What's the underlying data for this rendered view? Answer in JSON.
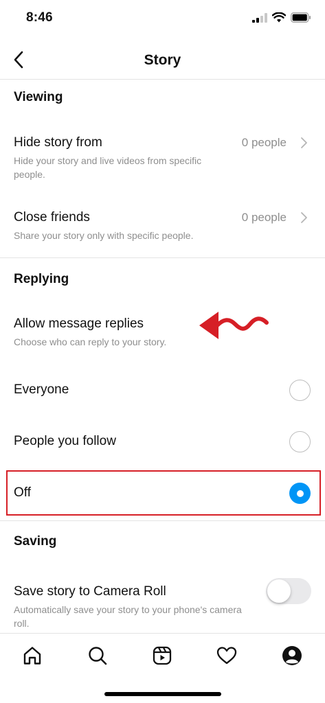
{
  "status_bar": {
    "time": "8:46"
  },
  "header": {
    "title": "Story"
  },
  "viewing": {
    "heading": "Viewing",
    "hide_story": {
      "title": "Hide story from",
      "value": "0 people",
      "desc": "Hide your story and live videos from specific people."
    },
    "close_friends": {
      "title": "Close friends",
      "value": "0 people",
      "desc": "Share your story only with specific people."
    }
  },
  "replying": {
    "heading": "Replying",
    "allow_replies": {
      "title": "Allow message replies",
      "desc": "Choose who can reply to your story."
    },
    "options": [
      {
        "label": "Everyone",
        "selected": false
      },
      {
        "label": "People you follow",
        "selected": false
      },
      {
        "label": "Off",
        "selected": true
      }
    ]
  },
  "saving": {
    "heading": "Saving",
    "save_camera_roll": {
      "title": "Save story to Camera Roll",
      "desc": "Automatically save your story to your phone's camera roll.",
      "enabled": false
    }
  },
  "tab_bar": {
    "items": [
      "home-icon",
      "search-icon",
      "reels-icon",
      "heart-icon",
      "profile-icon"
    ]
  },
  "colors": {
    "accent": "#0095f6",
    "annotation": "#d61f26",
    "muted": "#8e8e8e"
  }
}
